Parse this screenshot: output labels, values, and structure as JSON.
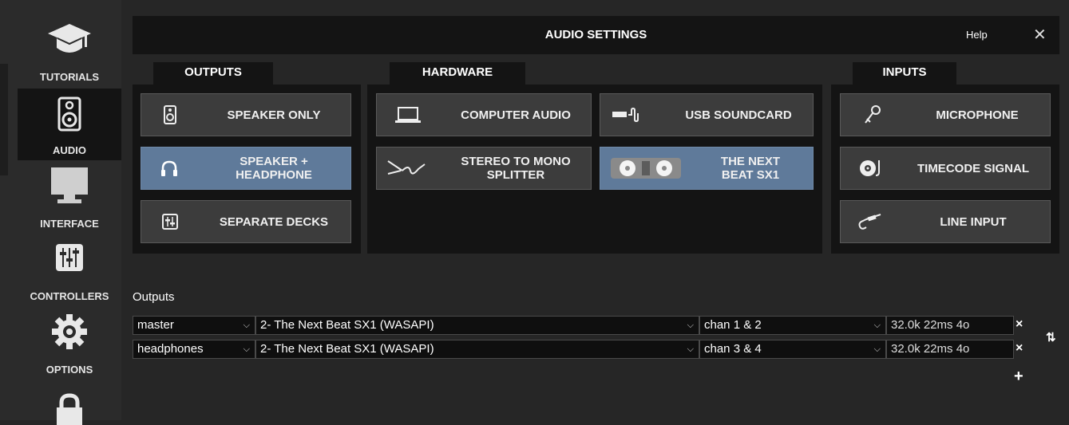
{
  "sidebar": {
    "items": [
      {
        "label": "TUTORIALS",
        "icon": "graduation-cap-icon"
      },
      {
        "label": "AUDIO",
        "icon": "speaker-icon"
      },
      {
        "label": "INTERFACE",
        "icon": "monitor-icon"
      },
      {
        "label": "CONTROLLERS",
        "icon": "mixer-icon"
      },
      {
        "label": "OPTIONS",
        "icon": "gear-icon"
      },
      {
        "label": "",
        "icon": "lock-icon"
      }
    ]
  },
  "header": {
    "title": "AUDIO SETTINGS",
    "help": "Help",
    "close": "✕"
  },
  "sections": {
    "outputs": {
      "tab": "OUTPUTS",
      "buttons": [
        "SPEAKER ONLY",
        "SPEAKER +\nHEADPHONE",
        "SEPARATE DECKS"
      ]
    },
    "hardware": {
      "tab": "HARDWARE",
      "buttons": [
        "COMPUTER AUDIO",
        "USB SOUNDCARD",
        "STEREO TO MONO\nSPLITTER",
        "THE NEXT\nBEAT SX1"
      ]
    },
    "inputs": {
      "tab": "INPUTS",
      "buttons": [
        "MICROPHONE",
        "TIMECODE SIGNAL",
        "LINE INPUT"
      ]
    }
  },
  "outputs_table": {
    "label": "Outputs",
    "rows": [
      {
        "channel": "master",
        "device": "2- The Next Beat SX1 (WASAPI)",
        "chan": "chan 1 & 2",
        "info": "32.0k 22ms 4o"
      },
      {
        "channel": "headphones",
        "device": "2- The Next Beat SX1 (WASAPI)",
        "chan": "chan 3 & 4",
        "info": "32.0k 22ms 4o"
      }
    ],
    "remove": "×",
    "add": "+",
    "swap": "⇅"
  },
  "colors": {
    "selected": "#5f7a9a",
    "button": "#3c3c3c",
    "panel": "#141414",
    "background": "#262626"
  }
}
